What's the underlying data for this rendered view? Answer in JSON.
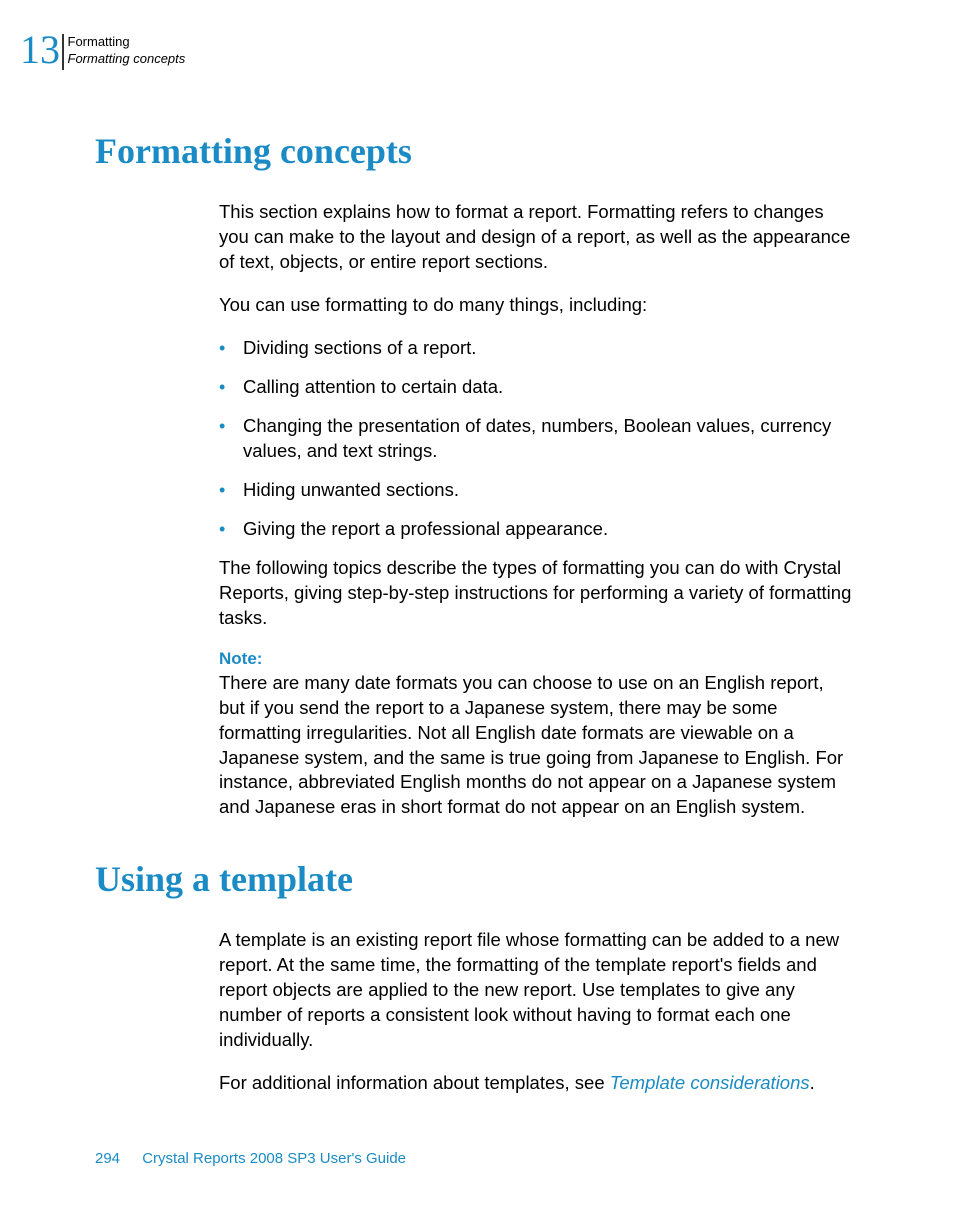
{
  "header": {
    "chapter_number": "13",
    "line1": "Formatting",
    "line2": "Formatting concepts"
  },
  "section1": {
    "title": "Formatting concepts",
    "para1": "This section explains how to format a report. Formatting refers to changes you can make to the layout and design of a report, as well as the appearance of text, objects, or entire report sections.",
    "para2": "You can use formatting to do many things, including:",
    "bullets": [
      "Dividing sections of a report.",
      "Calling attention to certain data.",
      "Changing the presentation of dates, numbers, Boolean values, currency values, and text strings.",
      "Hiding unwanted sections.",
      "Giving the report a professional appearance."
    ],
    "para3": "The following topics describe the types of formatting you can do with Crystal Reports, giving step-by-step instructions for performing a variety of formatting tasks.",
    "note_label": "Note:",
    "note_text": "There are many date formats you can choose to use on an English report, but if you send the report to a Japanese system, there may be some formatting irregularities. Not all English date formats are viewable on a Japanese system, and the same is true going from Japanese to English. For instance, abbreviated English months do not appear on a Japanese system and Japanese eras in short format do not appear on an English system."
  },
  "section2": {
    "title": "Using a template",
    "para1": "A template is an existing report file whose formatting can be added to a new report. At the same time, the formatting of the template report's fields and report objects are applied to the new report. Use templates to give any number of reports a consistent look without having to format each one individually.",
    "para2_prefix": "For additional information about templates, see ",
    "para2_link": "Template considerations",
    "para2_suffix": "."
  },
  "footer": {
    "page_number": "294",
    "title": "Crystal Reports 2008 SP3 User's Guide"
  }
}
